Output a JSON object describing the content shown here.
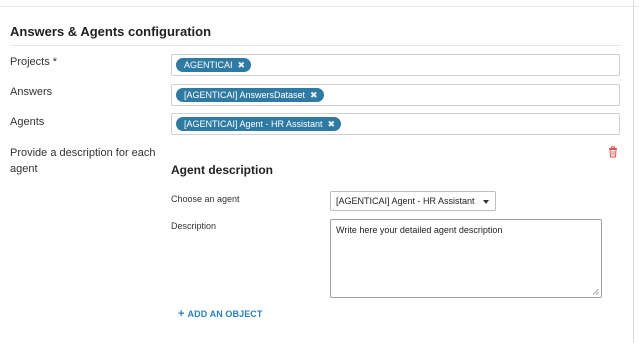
{
  "section": {
    "title": "Answers & Agents configuration"
  },
  "fields": {
    "projects": {
      "label": "Projects *",
      "tags": [
        "AGENTICAI"
      ]
    },
    "answers": {
      "label": "Answers",
      "tags": [
        "[AGENTICAI] AnswersDataset"
      ]
    },
    "agents": {
      "label": "Agents",
      "tags": [
        "[AGENTICAI] Agent - HR Assistant"
      ]
    }
  },
  "descriptions": {
    "label": "Provide a description for each agent",
    "delete_icon": "trash-icon",
    "item": {
      "title": "Agent description",
      "choose_label": "Choose an agent",
      "selected_agent": "[AGENTICAI] Agent - HR Assistant",
      "description_label": "Description",
      "description_value": "Write here your detailed agent description"
    },
    "add_button": "ADD AN OBJECT"
  },
  "colors": {
    "tag_bg": "#2f7aa3",
    "link": "#2a7fbf",
    "delete": "#d9534f"
  },
  "tag_remove_glyph": "✖"
}
